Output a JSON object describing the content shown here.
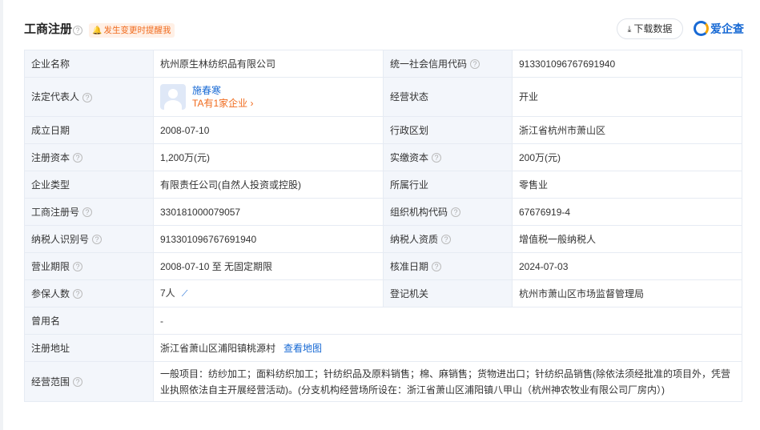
{
  "header": {
    "title": "工商注册",
    "remind_label": "发生变更时提醒我",
    "download_label": "下载数据",
    "brand": "爱企查"
  },
  "rows": {
    "r1": {
      "l1": "企业名称",
      "v1": "杭州原生林纺织品有限公司",
      "l2": "统一社会信用代码",
      "v2": "913301096767691940"
    },
    "r2": {
      "l1": "法定代表人",
      "person_name": "施春寒",
      "person_link": "TA有1家企业 ›",
      "l2": "经营状态",
      "v2": "开业"
    },
    "r3": {
      "l1": "成立日期",
      "v1": "2008-07-10",
      "l2": "行政区划",
      "v2": "浙江省杭州市萧山区"
    },
    "r4": {
      "l1": "注册资本",
      "v1": "1,200万(元)",
      "l2": "实缴资本",
      "v2": "200万(元)"
    },
    "r5": {
      "l1": "企业类型",
      "v1": "有限责任公司(自然人投资或控股)",
      "l2": "所属行业",
      "v2": "零售业"
    },
    "r6": {
      "l1": "工商注册号",
      "v1": "330181000079057",
      "l2": "组织机构代码",
      "v2": "67676919-4"
    },
    "r7": {
      "l1": "纳税人识别号",
      "v1": "913301096767691940",
      "l2": "纳税人资质",
      "v2": "增值税一般纳税人"
    },
    "r8": {
      "l1": "营业期限",
      "v1": "2008-07-10 至 无固定期限",
      "l2": "核准日期",
      "v2": "2024-07-03"
    },
    "r9": {
      "l1": "参保人数",
      "v1": "7人",
      "l2": "登记机关",
      "v2": "杭州市萧山区市场监督管理局"
    },
    "r10": {
      "l1": "曾用名",
      "v1": "-"
    },
    "r11": {
      "l1": "注册地址",
      "v1": "浙江省萧山区浦阳镇桃源村",
      "link": "查看地图"
    },
    "r12": {
      "l1": "经营范围",
      "v1": "一般项目：纺纱加工；面料纺织加工；针纺织品及原料销售；棉、麻销售；货物进出口；针纺织品销售(除依法须经批准的项目外，凭营业执照依法自主开展经营活动)。(分支机构经营场所设在：浙江省萧山区浦阳镇八甲山（杭州神农牧业有限公司厂房内）)"
    }
  },
  "icons": {
    "help": "help-circle-icon",
    "bell": "bell-icon",
    "download": "download-icon",
    "trend": "trend-chart-icon"
  },
  "colors": {
    "accent": "#1769d4",
    "warning": "#f06a1c",
    "label_bg": "#f3f6fb",
    "border": "#e6ebf3"
  }
}
